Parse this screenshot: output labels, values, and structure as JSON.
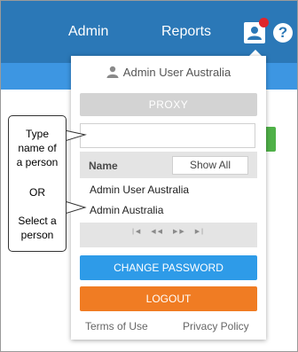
{
  "nav": {
    "admin_label": "Admin",
    "reports_label": "Reports",
    "help_label": "?",
    "notification_color": "#e0262b",
    "header_color": "#2b78b7"
  },
  "panel": {
    "user_name": "Admin User Australia",
    "proxy_label": "PROXY",
    "proxy_input_value": "",
    "list": {
      "column_header": "Name",
      "show_all_label": "Show All",
      "items": [
        "Admin User Australia",
        "Admin Australia"
      ]
    },
    "pager": [
      "|◀",
      "◀◀",
      "▶▶",
      "▶|"
    ],
    "change_password_label": "CHANGE PASSWORD",
    "logout_label": "LOGOUT",
    "terms_label": "Terms of Use",
    "privacy_label": "Privacy Policy",
    "change_password_color": "#2e9be8",
    "logout_color": "#f07c23"
  },
  "callout": {
    "line1": "Type",
    "line2": "name of",
    "line3": "a person",
    "or": "OR",
    "line4": "Select a",
    "line5": "person"
  }
}
